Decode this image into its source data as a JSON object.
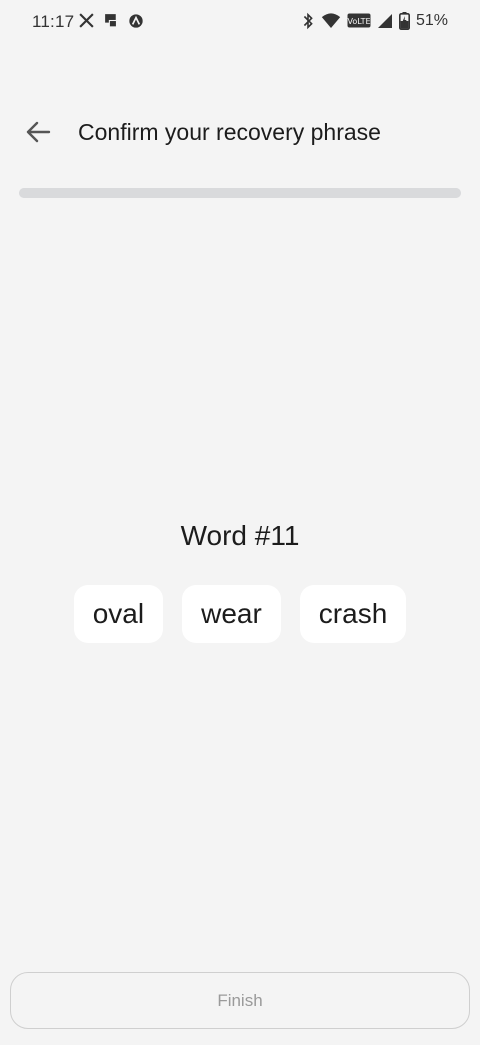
{
  "status_bar": {
    "time": "11:17",
    "battery": "51%",
    "left_icons": [
      "x-app-icon",
      "cast-icon",
      "no-distraction-icon"
    ],
    "right_icons": [
      "bluetooth-icon",
      "wifi-icon",
      "volte-icon",
      "signal-icon",
      "battery-charging-icon"
    ],
    "volte_label": "VoLTE"
  },
  "header": {
    "title": "Confirm your recovery phrase",
    "back_icon": "arrow-left-icon"
  },
  "progress": {
    "value": 1.0,
    "color": "#d9dadc"
  },
  "quiz": {
    "prompt": "Word #11",
    "options": [
      "oval",
      "wear",
      "crash"
    ]
  },
  "footer": {
    "finish_label": "Finish",
    "finish_enabled": false
  },
  "colors": {
    "background": "#f4f4f4",
    "chip": "#ffffff",
    "text": "#1c1c1c",
    "disabled_text": "#9a9a9a"
  }
}
